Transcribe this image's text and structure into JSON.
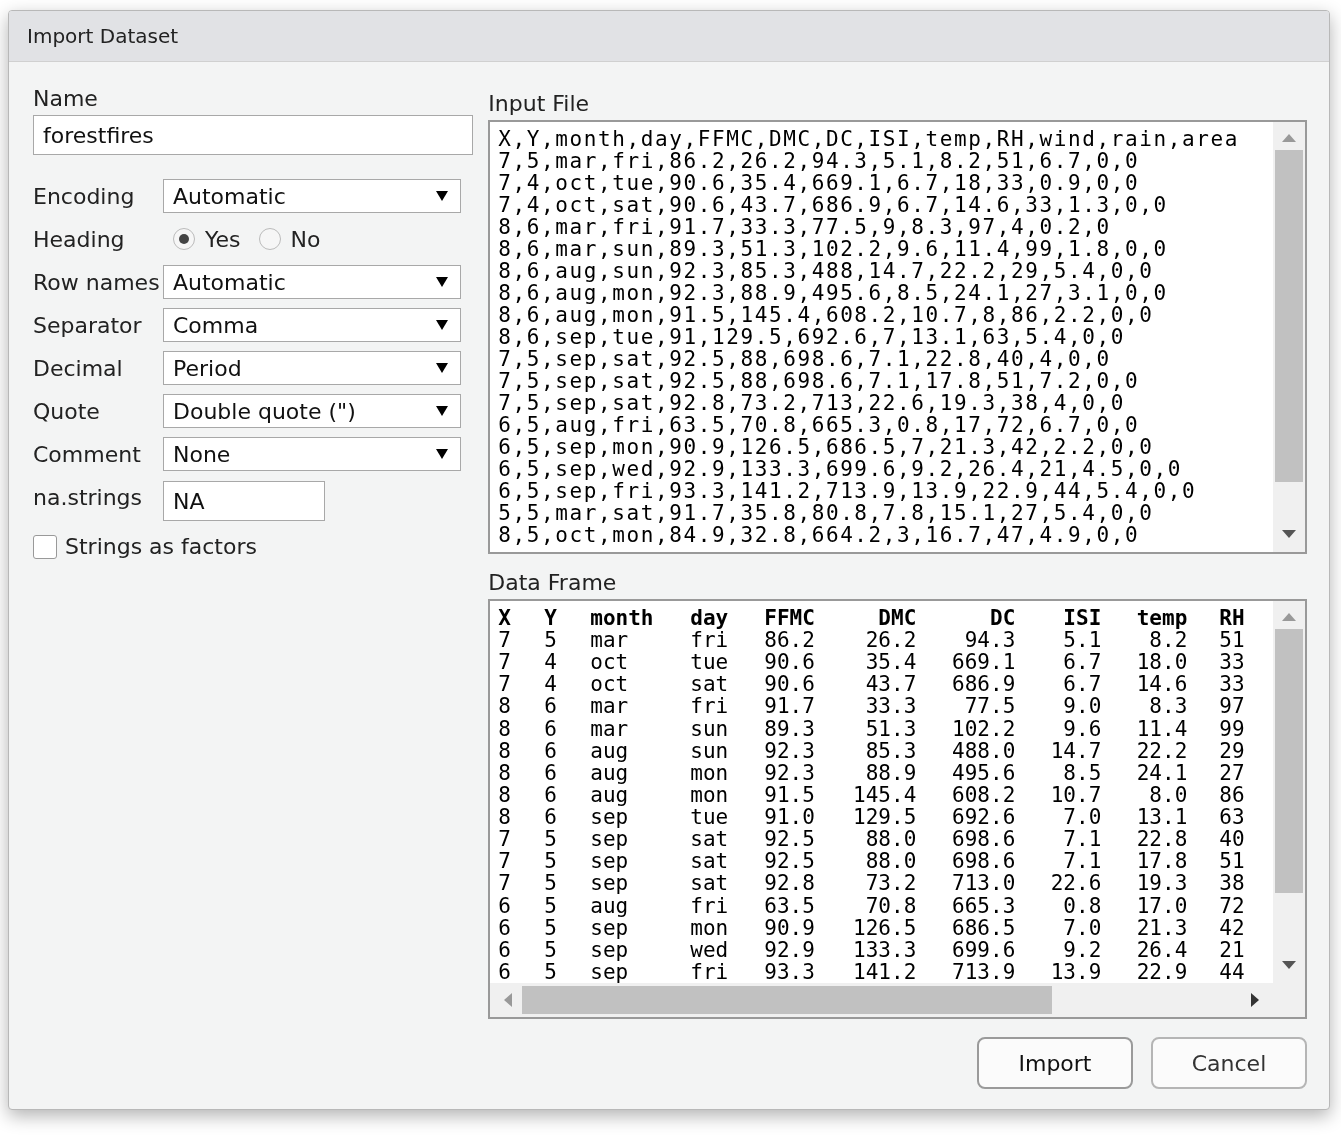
{
  "window": {
    "title": "Import Dataset"
  },
  "form": {
    "name_label": "Name",
    "name_value": "forestfires",
    "selects": [
      {
        "label": "Encoding",
        "value": "Automatic"
      },
      {
        "label": "Heading",
        "kind": "radio",
        "options": [
          {
            "label": "Yes",
            "selected": true
          },
          {
            "label": "No",
            "selected": false
          }
        ]
      },
      {
        "label": "Row names",
        "value": "Automatic"
      },
      {
        "label": "Separator",
        "value": "Comma"
      },
      {
        "label": "Decimal",
        "value": "Period"
      },
      {
        "label": "Quote",
        "value": "Double quote (\")"
      },
      {
        "label": "Comment",
        "value": "None"
      }
    ],
    "na_label": "na.strings",
    "na_value": "NA",
    "factors": {
      "label": "Strings as factors",
      "checked": false
    }
  },
  "input_file": {
    "title": "Input File",
    "lines": [
      "X,Y,month,day,FFMC,DMC,DC,ISI,temp,RH,wind,rain,area",
      "7,5,mar,fri,86.2,26.2,94.3,5.1,8.2,51,6.7,0,0",
      "7,4,oct,tue,90.6,35.4,669.1,6.7,18,33,0.9,0,0",
      "7,4,oct,sat,90.6,43.7,686.9,6.7,14.6,33,1.3,0,0",
      "8,6,mar,fri,91.7,33.3,77.5,9,8.3,97,4,0.2,0",
      "8,6,mar,sun,89.3,51.3,102.2,9.6,11.4,99,1.8,0,0",
      "8,6,aug,sun,92.3,85.3,488,14.7,22.2,29,5.4,0,0",
      "8,6,aug,mon,92.3,88.9,495.6,8.5,24.1,27,3.1,0,0",
      "8,6,aug,mon,91.5,145.4,608.2,10.7,8,86,2.2,0,0",
      "8,6,sep,tue,91,129.5,692.6,7,13.1,63,5.4,0,0",
      "7,5,sep,sat,92.5,88,698.6,7.1,22.8,40,4,0,0",
      "7,5,sep,sat,92.5,88,698.6,7.1,17.8,51,7.2,0,0",
      "7,5,sep,sat,92.8,73.2,713,22.6,19.3,38,4,0,0",
      "6,5,aug,fri,63.5,70.8,665.3,0.8,17,72,6.7,0,0",
      "6,5,sep,mon,90.9,126.5,686.5,7,21.3,42,2.2,0,0",
      "6,5,sep,wed,92.9,133.3,699.6,9.2,26.4,21,4.5,0,0",
      "6,5,sep,fri,93.3,141.2,713.9,13.9,22.9,44,5.4,0,0",
      "5,5,mar,sat,91.7,35.8,80.8,7.8,15.1,27,5.4,0,0",
      "8,5,oct,mon,84.9,32.8,664.2,3,16.7,47,4.9,0,0"
    ]
  },
  "data_frame": {
    "title": "Data Frame",
    "columns": [
      "X",
      "Y",
      "month",
      "day",
      "FFMC",
      "DMC",
      "DC",
      "ISI",
      "temp",
      "RH"
    ],
    "rows": [
      [
        "7",
        "5",
        "mar",
        "fri",
        "86.2",
        "26.2",
        "94.3",
        "5.1",
        "8.2",
        "51"
      ],
      [
        "7",
        "4",
        "oct",
        "tue",
        "90.6",
        "35.4",
        "669.1",
        "6.7",
        "18.0",
        "33"
      ],
      [
        "7",
        "4",
        "oct",
        "sat",
        "90.6",
        "43.7",
        "686.9",
        "6.7",
        "14.6",
        "33"
      ],
      [
        "8",
        "6",
        "mar",
        "fri",
        "91.7",
        "33.3",
        "77.5",
        "9.0",
        "8.3",
        "97"
      ],
      [
        "8",
        "6",
        "mar",
        "sun",
        "89.3",
        "51.3",
        "102.2",
        "9.6",
        "11.4",
        "99"
      ],
      [
        "8",
        "6",
        "aug",
        "sun",
        "92.3",
        "85.3",
        "488.0",
        "14.7",
        "22.2",
        "29"
      ],
      [
        "8",
        "6",
        "aug",
        "mon",
        "92.3",
        "88.9",
        "495.6",
        "8.5",
        "24.1",
        "27"
      ],
      [
        "8",
        "6",
        "aug",
        "mon",
        "91.5",
        "145.4",
        "608.2",
        "10.7",
        "8.0",
        "86"
      ],
      [
        "8",
        "6",
        "sep",
        "tue",
        "91.0",
        "129.5",
        "692.6",
        "7.0",
        "13.1",
        "63"
      ],
      [
        "7",
        "5",
        "sep",
        "sat",
        "92.5",
        "88.0",
        "698.6",
        "7.1",
        "22.8",
        "40"
      ],
      [
        "7",
        "5",
        "sep",
        "sat",
        "92.5",
        "88.0",
        "698.6",
        "7.1",
        "17.8",
        "51"
      ],
      [
        "7",
        "5",
        "sep",
        "sat",
        "92.8",
        "73.2",
        "713.0",
        "22.6",
        "19.3",
        "38"
      ],
      [
        "6",
        "5",
        "aug",
        "fri",
        "63.5",
        "70.8",
        "665.3",
        "0.8",
        "17.0",
        "72"
      ],
      [
        "6",
        "5",
        "sep",
        "mon",
        "90.9",
        "126.5",
        "686.5",
        "7.0",
        "21.3",
        "42"
      ],
      [
        "6",
        "5",
        "sep",
        "wed",
        "92.9",
        "133.3",
        "699.6",
        "9.2",
        "26.4",
        "21"
      ],
      [
        "6",
        "5",
        "sep",
        "fri",
        "93.3",
        "141.2",
        "713.9",
        "13.9",
        "22.9",
        "44"
      ]
    ]
  },
  "buttons": [
    {
      "label": "Import",
      "kind": "primary"
    },
    {
      "label": "Cancel",
      "kind": "secondary"
    }
  ]
}
